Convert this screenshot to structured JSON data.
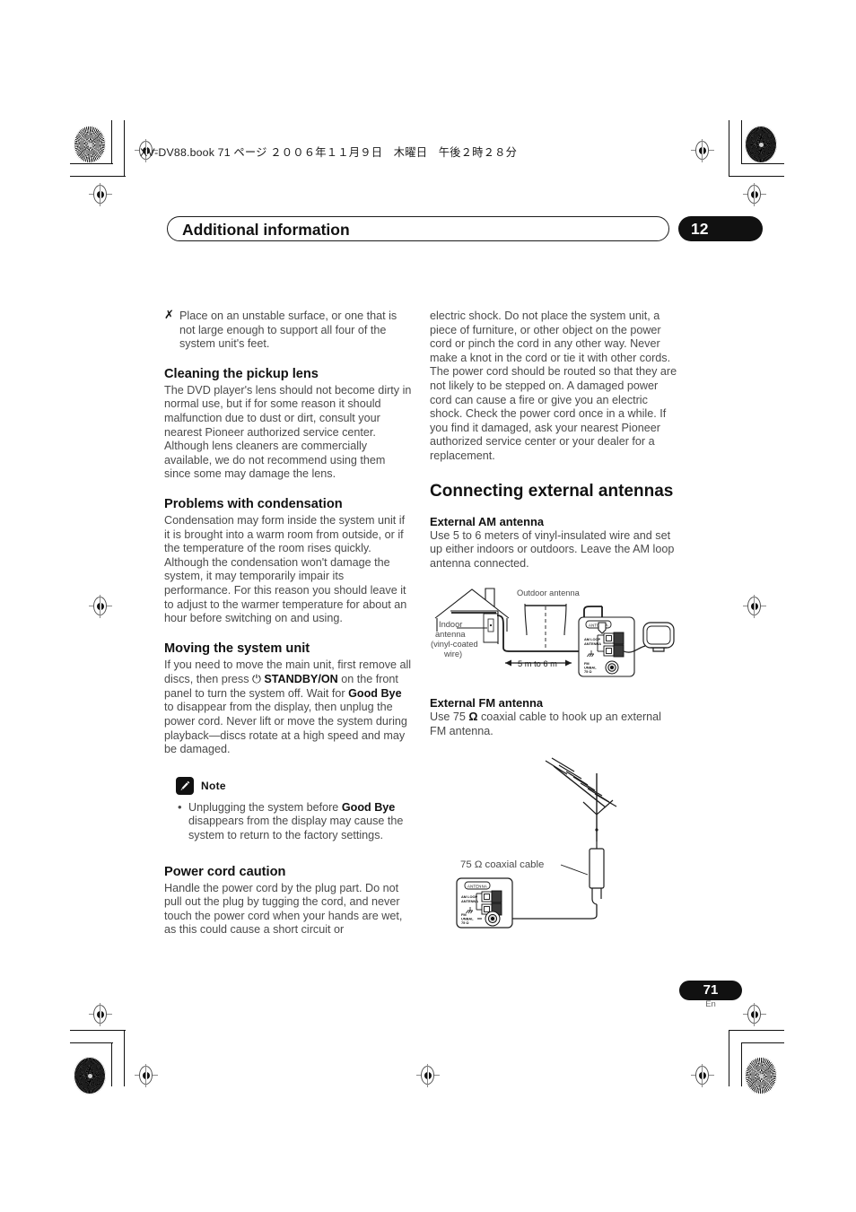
{
  "header": {
    "file_line": "XV-DV88.book  71 ページ  ２００６年１１月９日　木曜日　午後２時２８分"
  },
  "chapter": {
    "title": "Additional information",
    "number": "12"
  },
  "left_column": {
    "intro_bullet_mark": "✗",
    "intro_bullet": "Place on an unstable surface, or one that is not large enough to support all four of the system unit's feet.",
    "sections": [
      {
        "heading": "Cleaning the pickup lens",
        "body": "The DVD player's lens should not become dirty in normal use, but if for some reason it should malfunction due to dust or dirt, consult your nearest Pioneer authorized service center. Although lens cleaners are commercially available, we do not recommend using them since some may damage the lens."
      },
      {
        "heading": "Problems with condensation",
        "body": "Condensation may form inside the system unit if it is brought into a warm room from outside, or if the temperature of the room rises quickly. Although the condensation won't damage the system, it may temporarily impair its performance. For this reason you should leave it to adjust to the warmer temperature for about an hour before switching on and using."
      }
    ],
    "moving": {
      "heading": "Moving the system unit",
      "part1": "If you need to move the main unit, first remove all discs, then press ",
      "power_symbol": "⏻",
      "standby_label": "STANDBY/ON",
      "part2": " on the front panel to turn the system off. Wait for ",
      "goodbye": "Good Bye",
      "part3": " to disappear from the display, then unplug the power cord. Never lift or move the system during playback—discs rotate at a high speed and may be damaged."
    },
    "note": {
      "icon": "pencil-icon",
      "label": "Note",
      "items": [
        {
          "part1": "Unplugging the system before ",
          "emphasis": "Good Bye",
          "part2": " disappears from the display may cause the system to return to the factory settings."
        }
      ]
    },
    "power_cord": {
      "heading": "Power cord caution",
      "body": "Handle the power cord by the plug part. Do not pull out the plug by tugging the cord, and never touch the power cord when your hands are wet, as this could cause a short circuit or"
    }
  },
  "right_column": {
    "continuation": "electric shock. Do not place the system unit, a piece of furniture, or other object on the power cord or pinch the cord in any other way. Never make a knot in the cord or tie it with other cords. The power cord should be routed so that they are not likely to be stepped on. A damaged power cord can cause a fire or give you an electric shock. Check the power cord once in a while. If you find it damaged, ask your nearest Pioneer authorized service center or your dealer for a replacement.",
    "main_heading": "Connecting external antennas",
    "am": {
      "heading": "External AM antenna",
      "body": "Use 5 to 6 meters of vinyl-insulated wire and set up either indoors or outdoors. Leave the AM loop antenna connected.",
      "figure_labels": {
        "outdoor_antenna": "Outdoor antenna",
        "indoor_line1": "Indoor",
        "indoor_line2": "antenna",
        "indoor_line3": "(vinyl-coated",
        "indoor_line4": "wire)",
        "distance": "5 m to 6 m",
        "terminal_block": "ANTENNA",
        "am_loop_line1": "AM LOOP",
        "am_loop_line2": "ANTENNA",
        "fm_line1": "FM",
        "fm_line2": "UNBAL",
        "fm_line3": "75 Ω"
      }
    },
    "fm": {
      "heading": "External FM antenna",
      "body_part1": "Use 75 ",
      "ohm": "Ω",
      "body_part2": " coaxial cable to hook up an external FM antenna.",
      "figure_labels": {
        "coax_label": "75 Ω coaxial cable",
        "terminal_block": "ANTENNA",
        "am_loop_line1": "AM LOOP",
        "am_loop_line2": "ANTENNA",
        "fm_line1": "FM",
        "fm_line2": "UNBAL",
        "fm_line3": "75 Ω"
      }
    }
  },
  "footer": {
    "page_number": "71",
    "language": "En"
  }
}
